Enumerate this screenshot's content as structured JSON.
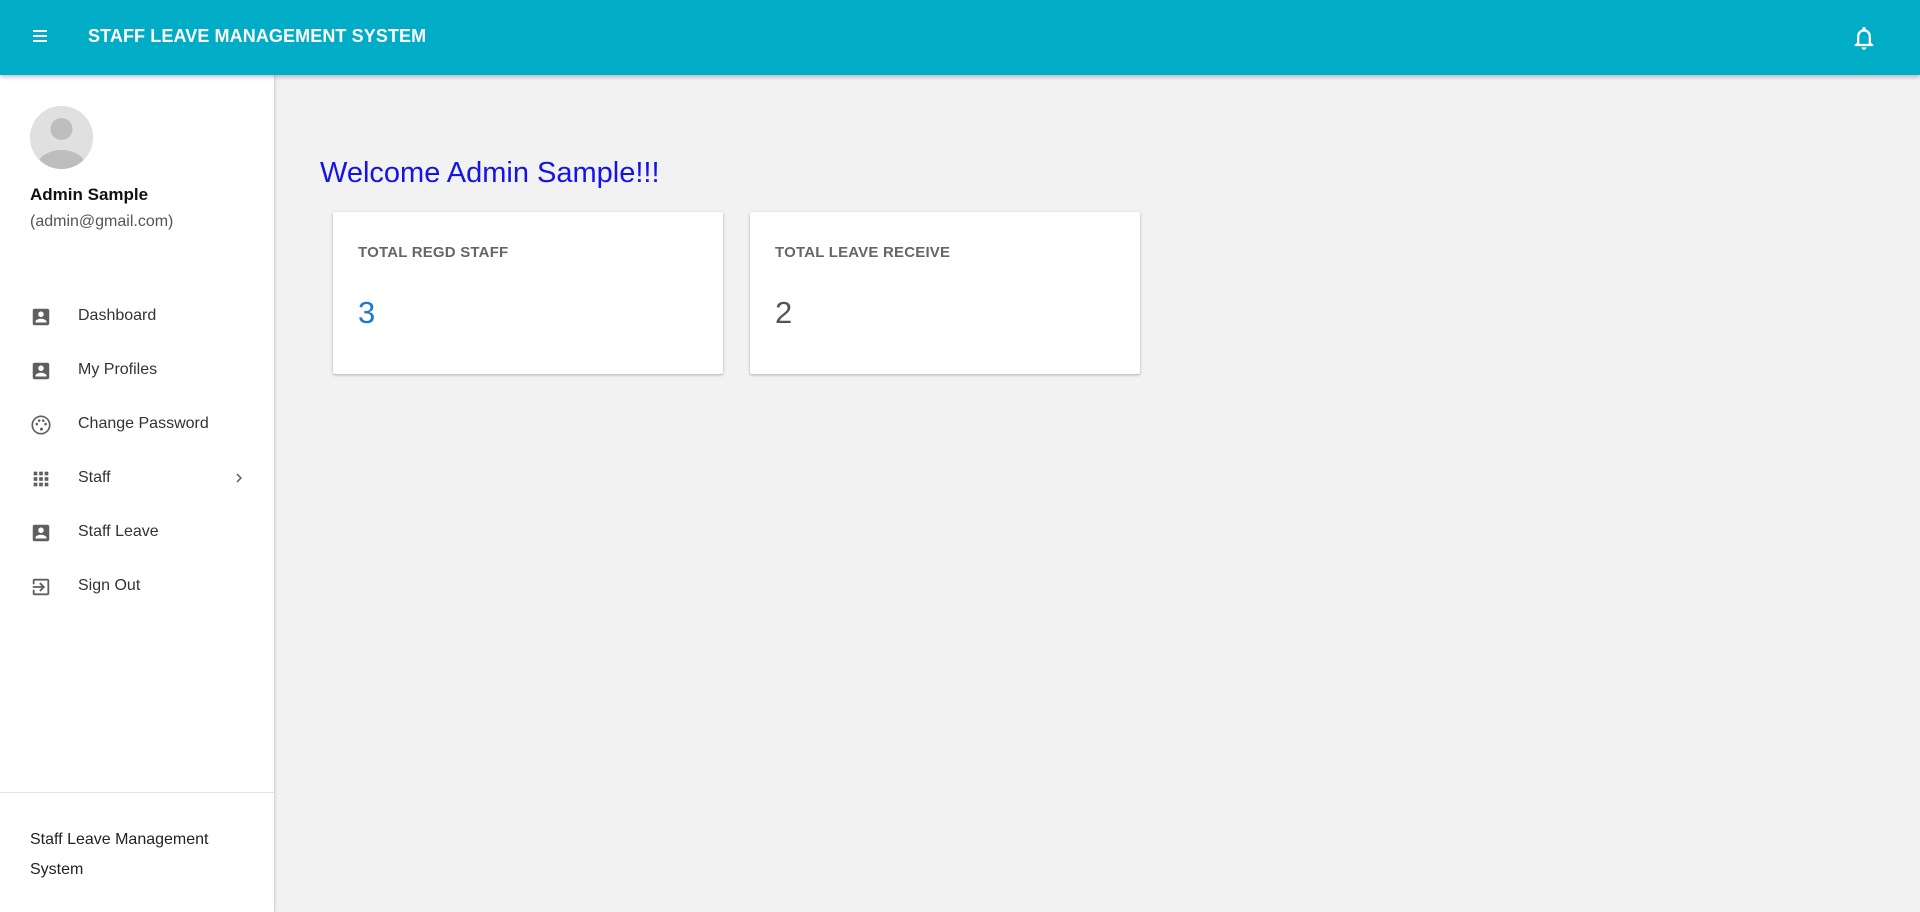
{
  "header": {
    "title": "STAFF LEAVE MANAGEMENT SYSTEM",
    "menu_icon": "hamburger-menu-icon",
    "notification_icon": "bell-icon",
    "background_color": "#00acc6"
  },
  "user": {
    "name": "Admin Sample",
    "email": "(admin@gmail.com)"
  },
  "sidebar": {
    "items": [
      {
        "label": "Dashboard",
        "icon": "account-box-icon"
      },
      {
        "label": "My Profiles",
        "icon": "account-box-icon"
      },
      {
        "label": "Change Password",
        "icon": "palette-icon"
      },
      {
        "label": "Staff",
        "icon": "apps-grid-icon",
        "has_submenu": true
      },
      {
        "label": "Staff Leave",
        "icon": "account-box-icon"
      },
      {
        "label": "Sign Out",
        "icon": "exit-to-app-icon"
      }
    ],
    "footer": "Staff Leave Management System"
  },
  "main": {
    "welcome": "Welcome Admin Sample!!!",
    "welcome_color": "#1414e6",
    "cards": [
      {
        "title": "TOTAL REGD STAFF",
        "value": "3",
        "value_color": "#1e7ac8"
      },
      {
        "title": "TOTAL LEAVE RECEIVE",
        "value": "2",
        "value_color": "#555555"
      }
    ]
  }
}
